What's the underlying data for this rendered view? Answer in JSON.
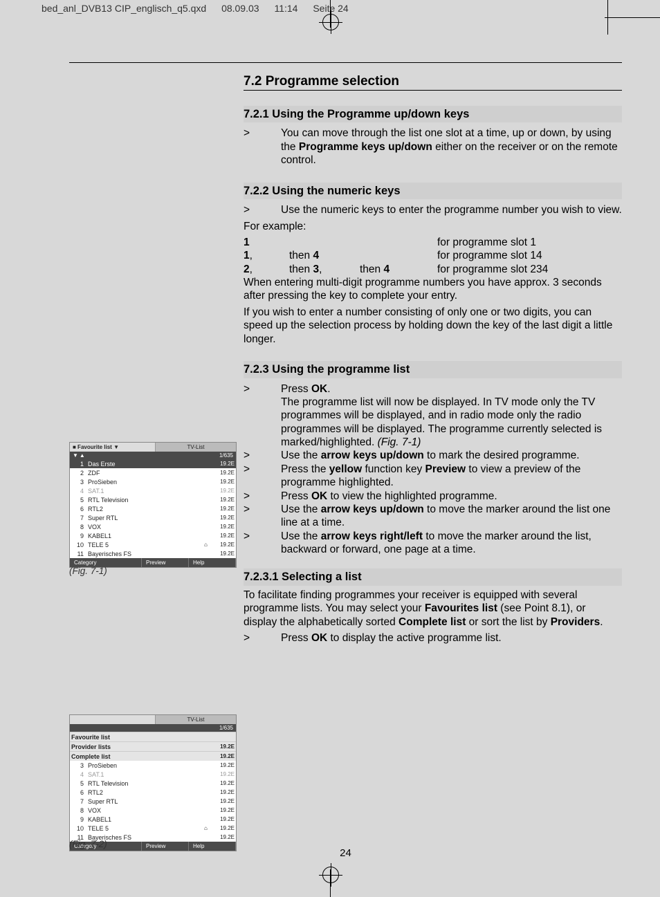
{
  "print_header": {
    "file": "bed_anl_DVB13 CIP_englisch_q5.qxd",
    "date": "08.09.03",
    "time": "11:14",
    "page": "Seite 24"
  },
  "page_number": "24",
  "h_7_2": "7.2 Programme selection",
  "h_7_2_1": "7.2.1 Using the Programme up/down keys",
  "bullet_7_2_1_a": "You can move through the list one slot at a time, up or down, by using the ",
  "bullet_7_2_1_b": "Programme keys up/down",
  "bullet_7_2_1_c": " either on the receiver or on the remote control.",
  "h_7_2_2": "7.2.2 Using the numeric keys",
  "bullet_7_2_2": "Use the numeric keys to enter the programme number you wish to view.",
  "for_example": "For example:",
  "ex1_a": "1",
  "ex1_b": "for programme slot 1",
  "ex2_a": "1",
  "ex2_b": ",",
  "ex2_c": "then ",
  "ex2_d": "4",
  "ex2_e": "for programme slot 14",
  "ex3_a": "2",
  "ex3_b": ",",
  "ex3_c": "then ",
  "ex3_d": "3",
  "ex3_e": ",",
  "ex3_f": "then ",
  "ex3_g": "4",
  "ex3_h": "  for programme slot 234",
  "para_multi": "When entering multi-digit programme numbers you have approx. 3 seconds after pressing the key to complete your entry.",
  "para_speed": "If you wish to enter a number consisting of only one or two digits, you can speed up the selection process by holding down the key of the last digit a little longer.",
  "h_7_2_3": "7.2.3 Using the programme list",
  "b_ok_a": "Press ",
  "b_ok_b": "OK",
  "b_ok_c": ".",
  "para_list": "The programme list will now be displayed. In TV mode only the TV programmes will be displayed, and in radio mode only the radio programmes will be displayed. The programme currently selected is marked/highlighted. ",
  "fig71_ref": "(Fig. 7-1)",
  "b_arrow_a": "Use the ",
  "b_arrow_b": "arrow keys up/down",
  "b_arrow_c": " to mark the desired programme.",
  "b_prev_a": "Press the ",
  "b_prev_b": "yellow",
  "b_prev_c": " function key ",
  "b_prev_d": "Preview",
  "b_prev_e": " to view a preview of the programme highlighted.",
  "b_okview_a": "Press ",
  "b_okview_b": "OK",
  "b_okview_c": " to view the highlighted programme.",
  "b_move_a": "Use the ",
  "b_move_b": "arrow keys up/down",
  "b_move_c": " to move the marker around the list one line at a time.",
  "b_page_a": "Use the ",
  "b_page_b": "arrow keys right/left",
  "b_page_c": " to move the marker around the list, backward or forward, one page at a time.",
  "h_7_2_3_1": "7.2.3.1 Selecting a list",
  "para_sel_a": "To facilitate finding programmes your receiver is equipped with several programme lists. You may select your ",
  "para_sel_b": "Favourites list",
  "para_sel_c": " (see Point 8.1), or display the alphabetically sorted ",
  "para_sel_d": "Complete list",
  "para_sel_e": " or sort the list by ",
  "para_sel_f": "Providers",
  "para_sel_g": ".",
  "b_active_a": "Press ",
  "b_active_b": "OK",
  "b_active_c": " to display the active programme list.",
  "gt": ">",
  "fig1": {
    "header_left": "■ Favourite list ▼",
    "header_right": "TV-List",
    "arrows": "▼▲",
    "count": "1/635",
    "channels": [
      {
        "n": "1",
        "name": "Das Erste",
        "sat": "19.2E",
        "sel": true
      },
      {
        "n": "2",
        "name": "ZDF",
        "sat": "19.2E"
      },
      {
        "n": "3",
        "name": "ProSieben",
        "sat": "19.2E"
      },
      {
        "n": "4",
        "name": "SAT.1",
        "sat": "19.2E",
        "dim": true
      },
      {
        "n": "5",
        "name": "RTL Television",
        "sat": "19.2E"
      },
      {
        "n": "6",
        "name": "RTL2",
        "sat": "19.2E"
      },
      {
        "n": "7",
        "name": "Super RTL",
        "sat": "19.2E"
      },
      {
        "n": "8",
        "name": "VOX",
        "sat": "19.2E"
      },
      {
        "n": "9",
        "name": "KABEL1",
        "sat": "19.2E"
      },
      {
        "n": "10",
        "name": "TELE 5",
        "sat": "19.2E",
        "enc": "⌂"
      },
      {
        "n": "11",
        "name": "Bayerisches FS",
        "sat": "19.2E"
      }
    ],
    "footer": [
      "Category",
      "Preview",
      "Help"
    ],
    "caption": "(Fig. 7-1)"
  },
  "fig2": {
    "header_left": "",
    "header_right": "TV-List",
    "arrows": "",
    "count": "1/635",
    "menu": [
      {
        "name": "Favourite list",
        "sat": ""
      },
      {
        "name": "Provider lists",
        "sat": "19.2E"
      },
      {
        "name": "Complete list",
        "sat": "19.2E"
      }
    ],
    "channels": [
      {
        "n": "3",
        "name": "ProSieben",
        "sat": "19.2E"
      },
      {
        "n": "4",
        "name": "SAT.1",
        "sat": "19.2E",
        "dim": true
      },
      {
        "n": "5",
        "name": "RTL Television",
        "sat": "19.2E"
      },
      {
        "n": "6",
        "name": "RTL2",
        "sat": "19.2E"
      },
      {
        "n": "7",
        "name": "Super RTL",
        "sat": "19.2E"
      },
      {
        "n": "8",
        "name": "VOX",
        "sat": "19.2E"
      },
      {
        "n": "9",
        "name": "KABEL1",
        "sat": "19.2E"
      },
      {
        "n": "10",
        "name": "TELE 5",
        "sat": "19.2E",
        "enc": "⌂"
      },
      {
        "n": "11",
        "name": "Bayerisches FS",
        "sat": "19.2E"
      }
    ],
    "footer": [
      "Category",
      "Preview",
      "Help"
    ],
    "caption": "(Fig. 7-2)"
  }
}
